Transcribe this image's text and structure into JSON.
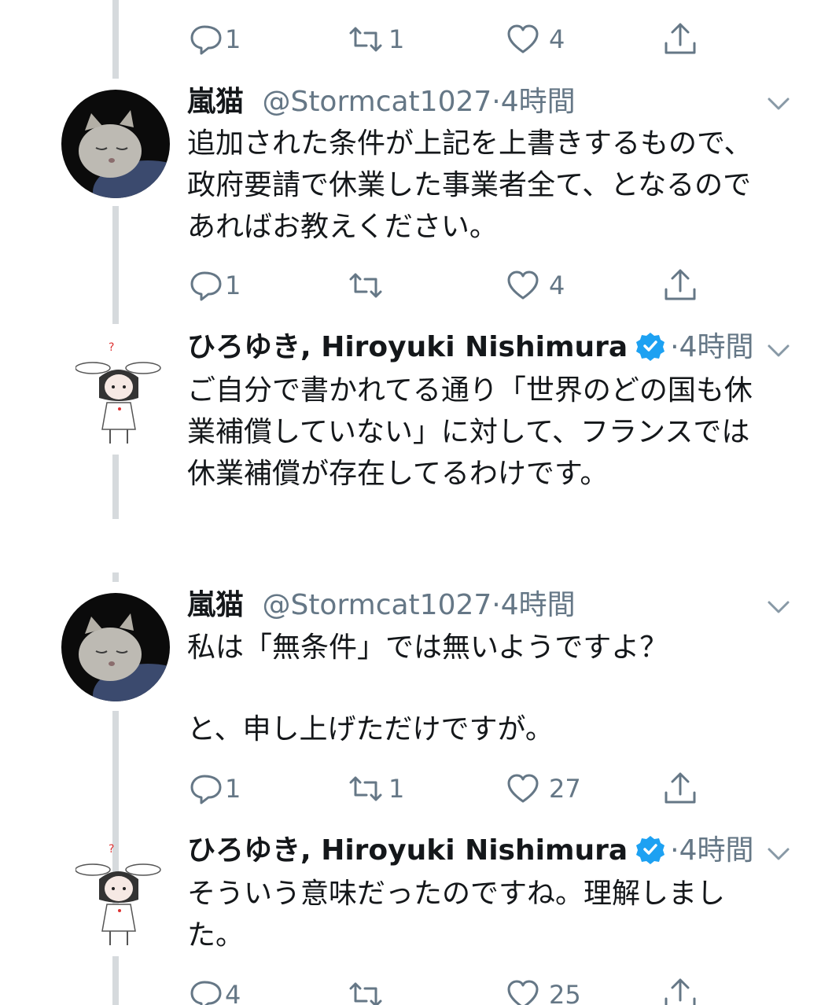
{
  "colors": {
    "line": "#d6dadd",
    "muted": "#657786",
    "verified": "#1da1f2",
    "text": "#14171a"
  },
  "top_actions": {
    "reply": "1",
    "retweet": "1",
    "like": "4"
  },
  "panel1": {
    "tweet1": {
      "name": "嵐猫",
      "handle": "@Stormcat1027",
      "time": "4時間",
      "text": "追加された条件が上記を上書きするもので、\n政府要請で休業した事業者全て、となるので\nあればお教えください。",
      "reply": "1",
      "retweet": "",
      "like": "4"
    },
    "tweet2": {
      "name": "ひろゆき, Hiroyuki Nishimura",
      "time": "4時間",
      "text": "ご自分で書かれてる通り「世界のどの国も休\n業補償していない」に対して、フランスでは\n休業補償が存在してるわけです。"
    }
  },
  "panel2": {
    "tweet1": {
      "name": "嵐猫",
      "handle": "@Stormcat1027",
      "time": "4時間",
      "text": "私は「無条件」では無いようですよ？\n\nと、申し上げただけですが。",
      "reply": "1",
      "retweet": "1",
      "like": "27"
    },
    "tweet2": {
      "name": "ひろゆき, Hiroyuki Nishimura",
      "time": "4時間",
      "text": "そういう意味だったのですね。理解しまし\nた。",
      "reply": "4",
      "retweet": "",
      "like": "25"
    }
  },
  "icons": [
    "reply-icon",
    "retweet-icon",
    "like-icon",
    "share-icon",
    "chevron-down-icon",
    "verified-badge-icon"
  ]
}
